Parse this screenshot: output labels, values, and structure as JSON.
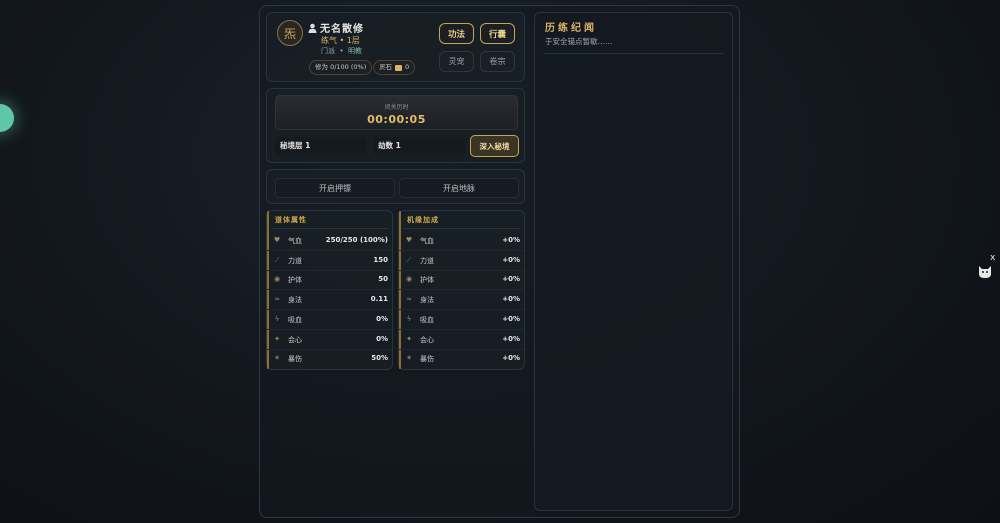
{
  "player": {
    "avatar_char": "炁",
    "name": "无名散修",
    "realm": "练气 • 1层",
    "sect_label": "门派",
    "sect_value": "明教",
    "cultivation": "修为 0/100 (0%)",
    "spirit_stone_label": "灵石",
    "spirit_stone_value": "0"
  },
  "menu": {
    "gongfa": "功法",
    "xingnang": "行囊",
    "lingchong": "灵宠",
    "juanzong": "卷宗"
  },
  "secret_realm": {
    "timer_label": "闭关历时",
    "timer_value": "00:00:05",
    "layer": "秘境层 1",
    "kalpa": "劫数 1",
    "enter_button": "深入秘境"
  },
  "actions": {
    "escort": "开启押镖",
    "vein": "开启地脉"
  },
  "body_stats": {
    "title": "道体属性",
    "rows": [
      {
        "icon": "heart-icon",
        "label": "气血",
        "value": "250/250 (100%)"
      },
      {
        "icon": "sword-icon",
        "label": "力道",
        "value": "150"
      },
      {
        "icon": "shield-icon",
        "label": "护体",
        "value": "50"
      },
      {
        "icon": "wind-icon",
        "label": "身法",
        "value": "0.11"
      },
      {
        "icon": "drain-icon",
        "label": "吸血",
        "value": "0%"
      },
      {
        "icon": "spark-icon",
        "label": "会心",
        "value": "0%"
      },
      {
        "icon": "burst-icon",
        "label": "暴伤",
        "value": "50%"
      }
    ]
  },
  "fortune_stats": {
    "title": "机缘加成",
    "rows": [
      {
        "icon": "heart-icon",
        "label": "气血",
        "value": "+0%"
      },
      {
        "icon": "sword-icon",
        "label": "力道",
        "value": "+0%"
      },
      {
        "icon": "shield-icon",
        "label": "护体",
        "value": "+0%"
      },
      {
        "icon": "wind-icon",
        "label": "身法",
        "value": "+0%"
      },
      {
        "icon": "drain-icon",
        "label": "吸血",
        "value": "+0%"
      },
      {
        "icon": "spark-icon",
        "label": "会心",
        "value": "+0%"
      },
      {
        "icon": "burst-icon",
        "label": "暴伤",
        "value": "+0%"
      }
    ]
  },
  "log": {
    "title": "历练纪闻",
    "line": "于安全锚点暂歇……"
  },
  "side_widget": {
    "close": "x",
    "icon": "cat-icon"
  }
}
